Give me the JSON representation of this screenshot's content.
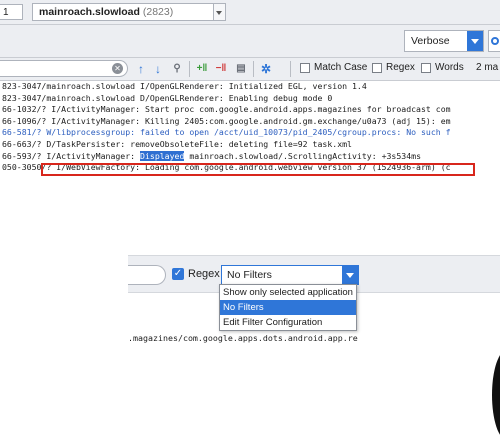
{
  "topbar": {
    "device_stub": "1",
    "process_name": "mainroach.slowload",
    "process_pid": "(2823)"
  },
  "log_level": {
    "value": "Verbose"
  },
  "toolbar": {
    "search_value": "",
    "match_case_label": "Match Case",
    "regex_label": "Regex",
    "words_label": "Words",
    "match_count": "2 ma"
  },
  "log_lines": [
    {
      "level": "I",
      "text": "823-3047/mainroach.slowload I/OpenGLRenderer: Initialized EGL, version 1.4"
    },
    {
      "level": "D",
      "text": "823-3047/mainroach.slowload D/OpenGLRenderer: Enabling debug mode 0"
    },
    {
      "level": "I",
      "text": "66-1032/? I/ActivityManager: Start proc com.google.android.apps.magazines for broadcast com"
    },
    {
      "level": "I",
      "text": "66-1096/? I/ActivityManager: Killing 2405:com.google.android.gm.exchange/u0a73 (adj 15): em"
    },
    {
      "level": "W",
      "text": "66-581/? W/libprocessgroup: failed to open /acct/uid_10073/pid_2405/cgroup.procs: No such f"
    },
    {
      "level": "D",
      "text": "66-663/? D/TaskPersister: removeObsoleteFile: deleting file=92 task.xml"
    },
    {
      "level": "I",
      "text": "66-593/? I/ActivityManager: Displayed mainroach.slowload/.ScrollingActivity: +3s534ms"
    },
    {
      "level": "I",
      "text": "050-3050/? I/WebViewFactory: Loading com.google.android.webview version 37 (1524936-arm) (c"
    }
  ],
  "highlight": {
    "prefix": "66-593/? I/ActivityManager: ",
    "word": "Displayed",
    "suffix": " mainroach.slowload/.ScrollingActivity: +3s534ms"
  },
  "inset": {
    "regex_label": "Regex",
    "filter_value": "No Filters",
    "dropdown_options": [
      "Show only selected application",
      "No Filters",
      "Edit Filter Configuration"
    ],
    "selected_option_index": 1,
    "log_fragment": ".magazines/com.google.apps.dots.android.app.re"
  },
  "icons": {
    "clear": "clear-search-icon",
    "up": "arrow-up-icon",
    "down": "arrow-down-icon",
    "find": "find-usages-icon",
    "add_occurrence": "add-next-occurrence-icon",
    "remove_occurrence": "remove-occurrence-icon",
    "select_all": "select-all-occurrences-icon",
    "settings": "filter-settings-icon"
  },
  "colors": {
    "accent": "#2f76d8",
    "highlight_border": "#d8261c",
    "warning_text": "#2c5ebf"
  }
}
